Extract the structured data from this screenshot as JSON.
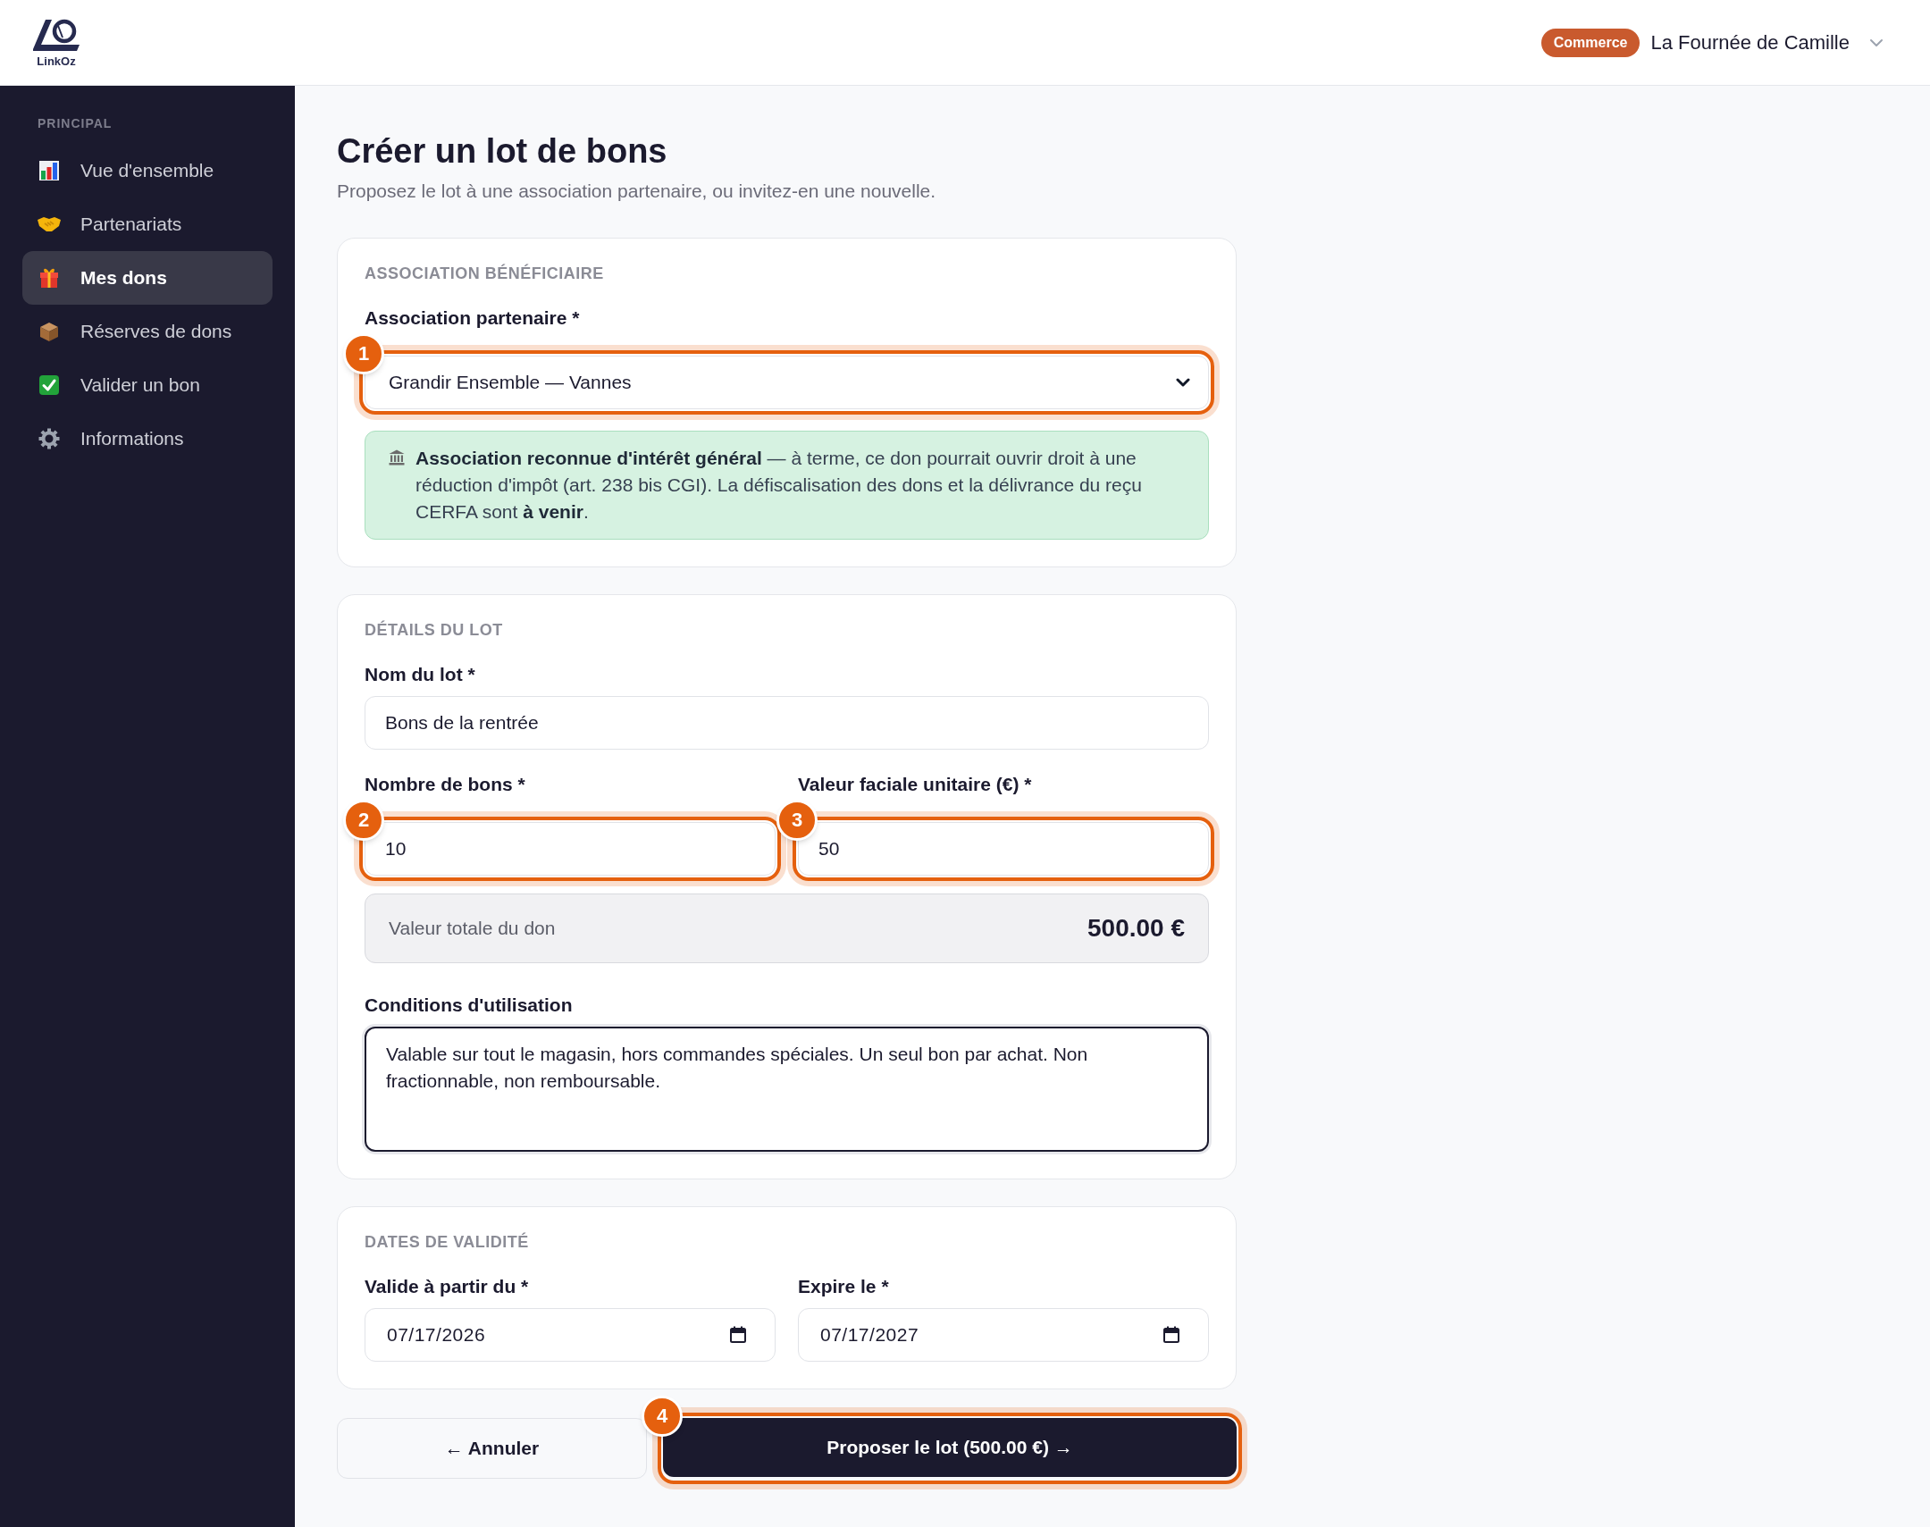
{
  "header": {
    "logo_text": "LinkOz",
    "role_badge": "Commerce",
    "account_name": "La Fournée de Camille"
  },
  "sidebar": {
    "section_title": "PRINCIPAL",
    "items": [
      {
        "label": "Vue d'ensemble",
        "selected": false
      },
      {
        "label": "Partenariats",
        "selected": false
      },
      {
        "label": "Mes dons",
        "selected": true
      },
      {
        "label": "Réserves de dons",
        "selected": false
      },
      {
        "label": "Valider un bon",
        "selected": false
      },
      {
        "label": "Informations",
        "selected": false
      }
    ]
  },
  "page": {
    "title": "Créer un lot de bons",
    "subtitle": "Proposez le lot à une association partenaire, ou invitez-en une nouvelle."
  },
  "sections": [
    {
      "heading": "ASSOCIATION BÉNÉFICIAIRE",
      "rows": [
        [
          {
            "kind": "select",
            "label": "Association partenaire *",
            "value": "Grandir Ensemble — Vannes",
            "focused": false,
            "marker": "1"
          }
        ],
        [
          {
            "kind": "notice",
            "text": "**Association reconnue d'intérêt général** — à terme, ce don pourrait ouvrir droit à une réduction d'impôt (art. 238 bis CGI). La défiscalisation des dons et la délivrance du reçu CERFA sont **à venir**."
          }
        ]
      ]
    },
    {
      "heading": "DÉTAILS DU LOT",
      "rows": [
        [
          {
            "kind": "text",
            "label": "Nom du lot *",
            "value": "Bons de la rentrée",
            "focused": false
          }
        ],
        [
          {
            "kind": "number",
            "label": "Nombre de bons *",
            "value": "10",
            "focused": false,
            "marker": "2"
          },
          {
            "kind": "number",
            "label": "Valeur faciale unitaire (€) *",
            "value": "50",
            "focused": false,
            "marker": "3"
          }
        ],
        [
          {
            "kind": "total",
            "label": "Valeur totale du don",
            "value": "500.00 €"
          }
        ],
        [
          {
            "kind": "textarea",
            "label": "Conditions d'utilisation",
            "value": "Valable sur tout le magasin, hors commandes spéciales. Un seul bon par achat. Non fractionnable, non remboursable.",
            "focused": true
          }
        ]
      ]
    },
    {
      "heading": "DATES DE VALIDITÉ",
      "rows": [
        [
          {
            "kind": "date",
            "label": "Valide à partir du *",
            "value": "07/17/2026",
            "focused": false
          },
          {
            "kind": "date",
            "label": "Expire le *",
            "value": "07/17/2027",
            "focused": false
          }
        ]
      ]
    }
  ],
  "actions": [
    {
      "kind": "secondary",
      "label": "← Annuler"
    },
    {
      "kind": "primary",
      "label": "Proposer le lot (500.00 €) →",
      "marker": "4"
    }
  ]
}
